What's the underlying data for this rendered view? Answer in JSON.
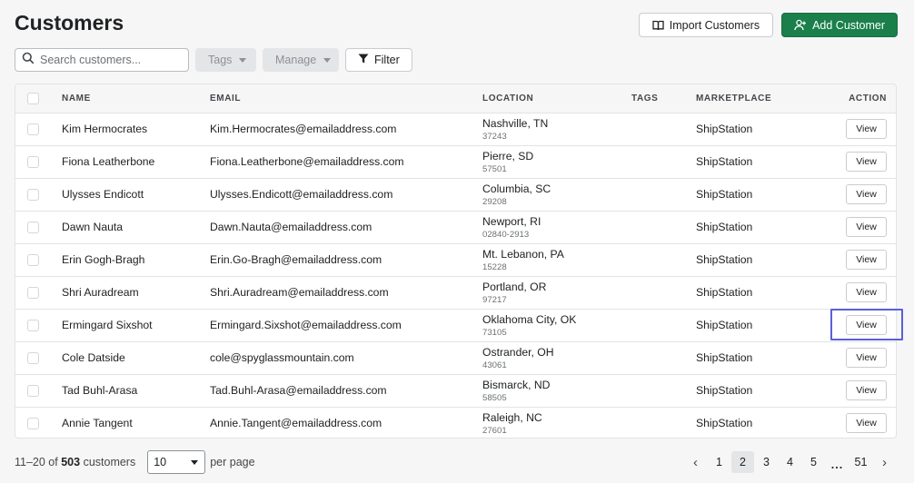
{
  "header": {
    "title": "Customers",
    "import_label": "Import Customers",
    "add_label": "Add Customer"
  },
  "toolbar": {
    "search_placeholder": "Search customers...",
    "tags_label": "Tags",
    "manage_label": "Manage",
    "filter_label": "Filter"
  },
  "table": {
    "columns": [
      "NAME",
      "EMAIL",
      "LOCATION",
      "TAGS",
      "MARKETPLACE",
      "ACTION"
    ],
    "view_label": "View",
    "rows": [
      {
        "name": "Kim Hermocrates",
        "email": "Kim.Hermocrates@emailaddress.com",
        "city": "Nashville, TN",
        "zip": "37243",
        "tags": "",
        "marketplace": "ShipStation"
      },
      {
        "name": "Fiona Leatherbone",
        "email": "Fiona.Leatherbone@emailaddress.com",
        "city": "Pierre, SD",
        "zip": "57501",
        "tags": "",
        "marketplace": "ShipStation"
      },
      {
        "name": "Ulysses Endicott",
        "email": "Ulysses.Endicott@emailaddress.com",
        "city": "Columbia, SC",
        "zip": "29208",
        "tags": "",
        "marketplace": "ShipStation"
      },
      {
        "name": "Dawn Nauta",
        "email": "Dawn.Nauta@emailaddress.com",
        "city": "Newport, RI",
        "zip": "02840-2913",
        "tags": "",
        "marketplace": "ShipStation"
      },
      {
        "name": "Erin Gogh-Bragh",
        "email": "Erin.Go-Bragh@emailaddress.com",
        "city": "Mt. Lebanon, PA",
        "zip": "15228",
        "tags": "",
        "marketplace": "ShipStation"
      },
      {
        "name": "Shri Auradream",
        "email": "Shri.Auradream@emailaddress.com",
        "city": "Portland, OR",
        "zip": "97217",
        "tags": "",
        "marketplace": "ShipStation"
      },
      {
        "name": "Ermingard Sixshot",
        "email": "Ermingard.Sixshot@emailaddress.com",
        "city": "Oklahoma City, OK",
        "zip": "73105",
        "tags": "",
        "marketplace": "ShipStation"
      },
      {
        "name": "Cole Datside",
        "email": "cole@spyglassmountain.com",
        "city": "Ostrander, OH",
        "zip": "43061",
        "tags": "",
        "marketplace": "ShipStation"
      },
      {
        "name": "Tad Buhl-Arasa",
        "email": "Tad.Buhl-Arasa@emailaddress.com",
        "city": "Bismarck, ND",
        "zip": "58505",
        "tags": "",
        "marketplace": "ShipStation"
      },
      {
        "name": "Annie Tangent",
        "email": "Annie.Tangent@emailaddress.com",
        "city": "Raleigh, NC",
        "zip": "27601",
        "tags": "",
        "marketplace": "ShipStation"
      }
    ]
  },
  "footer": {
    "range": "11–20 of",
    "total": "503",
    "total_suffix": "customers",
    "per_page_value": "10",
    "per_page_label": "per page",
    "pages": [
      "1",
      "2",
      "3",
      "4",
      "5",
      "...",
      "51"
    ],
    "current_page": "2"
  },
  "colors": {
    "primary": "#1a7f4b",
    "highlight": "#5b5fd6"
  }
}
